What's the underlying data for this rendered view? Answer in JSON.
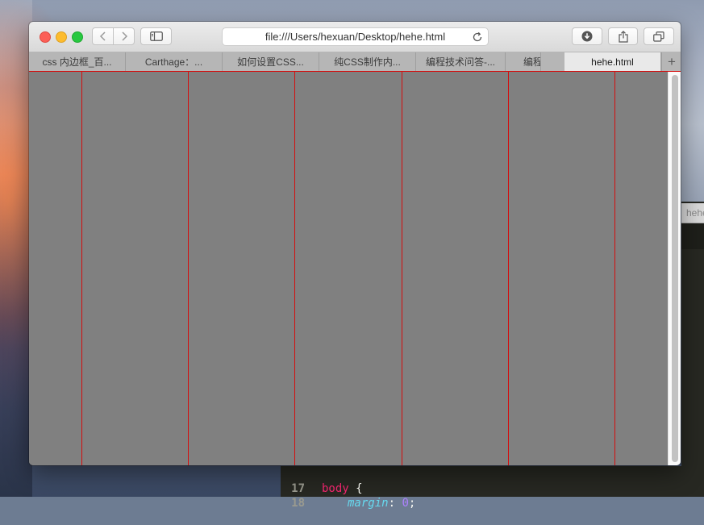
{
  "browser": {
    "address": "file:///Users/hexuan/Desktop/hehe.html",
    "tabs": [
      {
        "label": "css 内边框_百..."
      },
      {
        "label": "Carthage：..."
      },
      {
        "label": "如何设置CSS..."
      },
      {
        "label": "纯CSS制作内..."
      },
      {
        "label": "编程技术问答-..."
      },
      {
        "label": "编程"
      },
      {
        "label": "hehe.html"
      }
    ],
    "new_tab_label": "+"
  },
  "editor": {
    "tab_title": "hehe",
    "code": [
      {
        "line": "17",
        "selector": "body",
        "brace": " {"
      },
      {
        "line": "18",
        "property": "margin",
        "colon": ": ",
        "value": "0",
        "end": ";"
      }
    ]
  },
  "colors": {
    "page_background": "#808080",
    "column_line": "#d40d0d"
  }
}
